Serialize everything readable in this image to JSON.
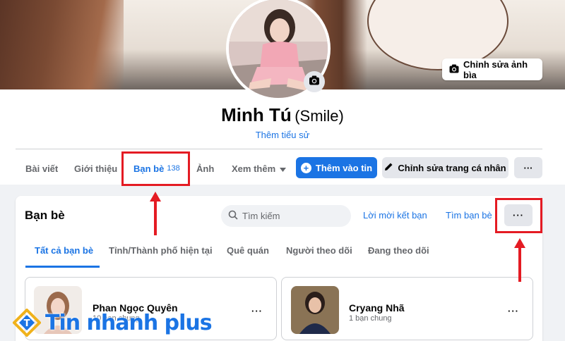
{
  "cover": {
    "edit_button_label": "Chỉnh sửa ảnh bìa"
  },
  "profile": {
    "name": "Minh Tú",
    "nickname": "(Smile)",
    "add_bio_link": "Thêm tiểu sử"
  },
  "tabs": [
    {
      "label": "Bài viết"
    },
    {
      "label": "Giới thiệu"
    },
    {
      "label": "Bạn bè",
      "count": "138"
    },
    {
      "label": "Ảnh"
    },
    {
      "label": "Xem thêm"
    }
  ],
  "actions": {
    "add_story": "Thêm vào tin",
    "edit_profile": "Chỉnh sửa trang cá nhân",
    "more": "···"
  },
  "friends_section": {
    "title": "Bạn bè",
    "search_placeholder": "Tìm kiếm",
    "friend_requests_link": "Lời mời kết bạn",
    "find_friends_link": "Tìm bạn bè",
    "more": "···",
    "subtabs": [
      {
        "label": "Tất cả bạn bè"
      },
      {
        "label": "Tỉnh/Thành phố hiện tại"
      },
      {
        "label": "Quê quán"
      },
      {
        "label": "Người theo dõi"
      },
      {
        "label": "Đang theo dõi"
      }
    ],
    "friends": [
      {
        "name": "Phan Ngọc Quyên",
        "mutual": "10 bạn chung",
        "more": "···"
      },
      {
        "name": "Cryang Nhã",
        "mutual": "1 bạn chung",
        "more": "···"
      }
    ]
  },
  "watermark": {
    "text": "Tin nhanh plus"
  },
  "colors": {
    "accent": "#1b74e4",
    "highlight": "#e41b23",
    "button_gray": "#e4e6eb"
  }
}
